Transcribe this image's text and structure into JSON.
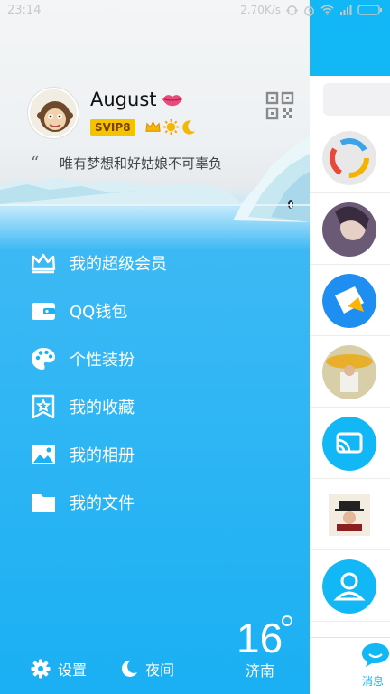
{
  "status_bar": {
    "time": "23:14",
    "net_speed": "2.70K/s",
    "icons": [
      "sync-icon",
      "alarm-icon",
      "wifi-icon",
      "signal-icon",
      "battery-icon"
    ]
  },
  "profile": {
    "name": "August",
    "badge": "SVIP8",
    "signature": "唯有梦想和好姑娘不可辜负",
    "quote_mark": "“",
    "level_icons": [
      "crown-icon",
      "sun-icon",
      "moon-icon"
    ]
  },
  "menu": [
    {
      "label": "我的超级会员",
      "icon": "crown-icon"
    },
    {
      "label": "QQ钱包",
      "icon": "wallet-icon"
    },
    {
      "label": "个性装扮",
      "icon": "palette-icon"
    },
    {
      "label": "我的收藏",
      "icon": "star-bookmark-icon"
    },
    {
      "label": "我的相册",
      "icon": "photo-icon"
    },
    {
      "label": "我的文件",
      "icon": "folder-icon"
    }
  ],
  "bottom": {
    "settings_label": "设置",
    "night_label": "夜间",
    "temperature": "16",
    "city": "济南"
  },
  "pane": {
    "tab_label": "消息"
  },
  "colors": {
    "accent": "#12b7f5",
    "drawer_blue": "#1ab0f3",
    "svip_gold": "#f4c300"
  }
}
